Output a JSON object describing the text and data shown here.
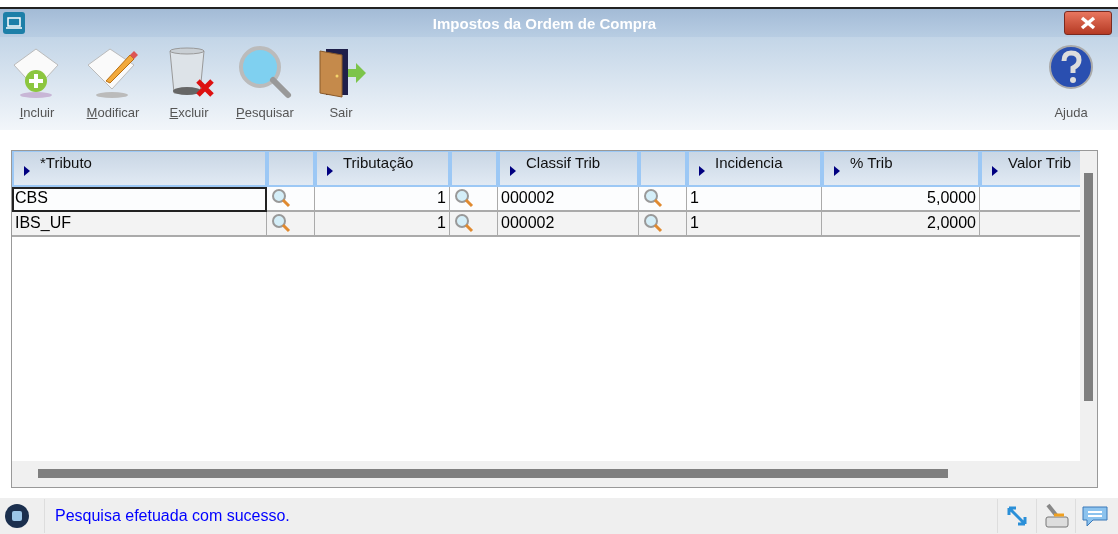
{
  "window": {
    "title": "Impostos da Ordem de Compra"
  },
  "toolbar": [
    {
      "label": "Incluir",
      "kind": "add",
      "mnemonic": true
    },
    {
      "label": "Modificar",
      "kind": "edit",
      "mnemonic": true
    },
    {
      "label": "Excluir",
      "kind": "delete",
      "mnemonic": true
    },
    {
      "label": "Pesquisar",
      "kind": "search",
      "mnemonic": true
    },
    {
      "label": "Sair",
      "kind": "exit",
      "mnemonic": false
    }
  ],
  "help": {
    "label": "Ajuda"
  },
  "table": {
    "columns": [
      {
        "kind": "text",
        "label": "*Tributo"
      },
      {
        "kind": "lookup"
      },
      {
        "kind": "text",
        "label": "Tributação"
      },
      {
        "kind": "lookup"
      },
      {
        "kind": "text",
        "label": "Classif Trib"
      },
      {
        "kind": "lookup"
      },
      {
        "kind": "text",
        "label": "Incidencia"
      },
      {
        "kind": "text",
        "label": "% Trib"
      },
      {
        "kind": "text",
        "label": "Valor Trib"
      }
    ],
    "rows": [
      {
        "selected": true,
        "cells": [
          {
            "kind": "text",
            "value": "CBS"
          },
          {
            "kind": "lookup"
          },
          {
            "kind": "text",
            "value": "1"
          },
          {
            "kind": "lookup"
          },
          {
            "kind": "text",
            "value": "000002"
          },
          {
            "kind": "lookup"
          },
          {
            "kind": "text",
            "value": "1"
          },
          {
            "kind": "text",
            "value": "5,0000"
          },
          {
            "kind": "empty"
          }
        ]
      },
      {
        "selected": false,
        "cells": [
          {
            "kind": "text",
            "value": "IBS_UF"
          },
          {
            "kind": "lookup"
          },
          {
            "kind": "text",
            "value": "1"
          },
          {
            "kind": "lookup"
          },
          {
            "kind": "text",
            "value": "000002"
          },
          {
            "kind": "lookup"
          },
          {
            "kind": "text",
            "value": "1"
          },
          {
            "kind": "text",
            "value": "2,0000"
          },
          {
            "kind": "empty"
          }
        ]
      }
    ]
  },
  "status_bar": {
    "message": "Pesquisa efetuada com sucesso."
  }
}
